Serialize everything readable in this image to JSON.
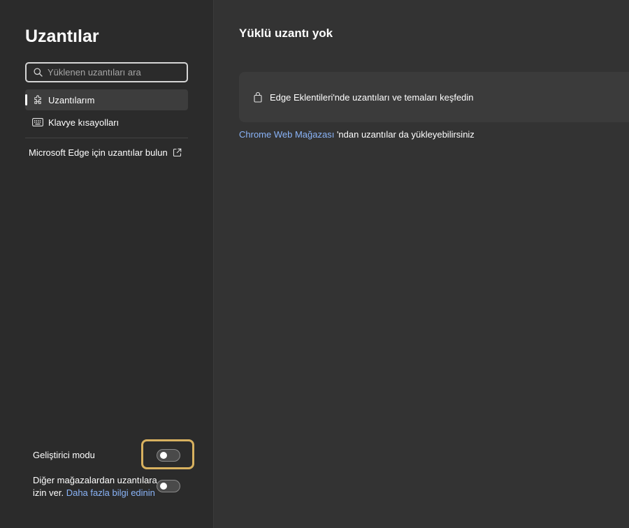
{
  "sidebar": {
    "title": "Uzantılar",
    "search": {
      "placeholder": "Yüklenen uzantıları ara",
      "value": ""
    },
    "nav": [
      {
        "label": "Uzantılarım",
        "icon": "puzzle-icon",
        "active": true
      },
      {
        "label": "Klavye kısayolları",
        "icon": "keyboard-icon",
        "active": false
      }
    ],
    "find_link": {
      "label": "Microsoft Edge için uzantılar bulun",
      "icon": "external-link-icon"
    },
    "developer_mode": {
      "label": "Geliştirici modu",
      "enabled": false
    },
    "other_stores": {
      "label_line1": "Diğer mağazalardan uzantılara",
      "label_line2": "izin ver.",
      "link": "Daha fazla bilgi edinin",
      "enabled": false
    }
  },
  "main": {
    "title": "Yüklü uzantı yok",
    "card": {
      "text": "Edge Eklentileri'nde uzantıları ve temaları keşfedin",
      "icon": "shopping-bag-icon"
    },
    "store_line": {
      "link": "Chrome Web Mağazası",
      "text": " 'ndan uzantılar da yükleyebilirsiniz"
    }
  },
  "colors": {
    "sidebar_bg": "#2b2b2b",
    "main_bg": "#333333",
    "card_bg": "#3b3b3b",
    "link": "#8ab4f8",
    "highlight": "#d8b15f"
  }
}
